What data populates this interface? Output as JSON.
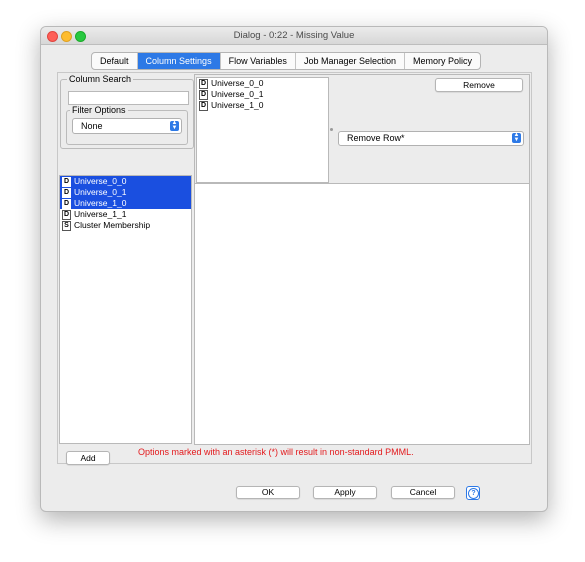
{
  "window": {
    "title": "Dialog - 0:22 - Missing Value"
  },
  "tabs": [
    {
      "label": "Default",
      "active": false
    },
    {
      "label": "Column Settings",
      "active": true
    },
    {
      "label": "Flow Variables",
      "active": false
    },
    {
      "label": "Job Manager Selection",
      "active": false
    },
    {
      "label": "Memory Policy",
      "active": false
    }
  ],
  "column_search": {
    "label": "Column Search",
    "value": ""
  },
  "filter_options": {
    "label": "Filter Options",
    "selected": "None"
  },
  "columns": [
    {
      "type": "D",
      "name": "Universe_0_0",
      "selected": true
    },
    {
      "type": "D",
      "name": "Universe_0_1",
      "selected": true
    },
    {
      "type": "D",
      "name": "Universe_1_0",
      "selected": true
    },
    {
      "type": "D",
      "name": "Universe_1_1",
      "selected": false
    },
    {
      "type": "S",
      "name": "Cluster Membership",
      "selected": false
    }
  ],
  "setting": {
    "columns": [
      {
        "type": "D",
        "name": "Universe_0_0"
      },
      {
        "type": "D",
        "name": "Universe_0_1"
      },
      {
        "type": "D",
        "name": "Universe_1_0"
      }
    ],
    "remove_label": "Remove",
    "method": "Remove Row*"
  },
  "add_label": "Add",
  "warning": "Options marked with an asterisk (*) will result in non-standard PMML.",
  "footer": {
    "ok": "OK",
    "apply": "Apply",
    "cancel": "Cancel",
    "help": "?"
  },
  "colors": {
    "accent": "#2d79e6",
    "selection": "#1a4fe0",
    "warning": "#e3191c"
  }
}
